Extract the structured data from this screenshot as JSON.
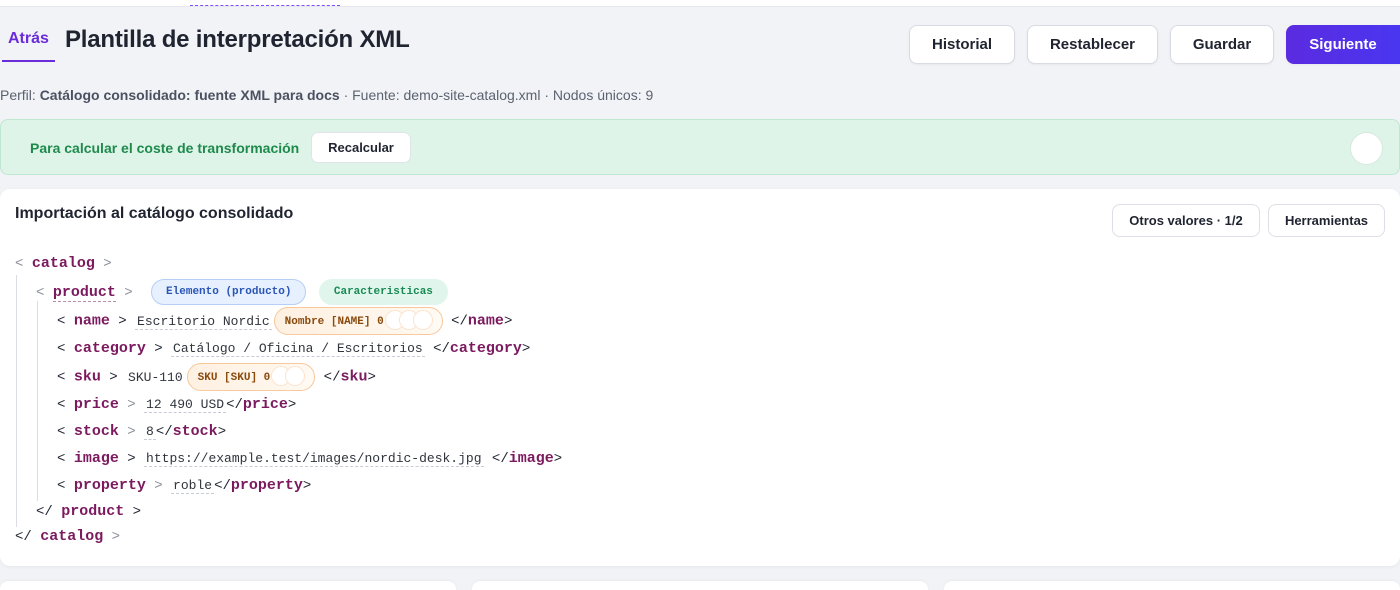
{
  "header": {
    "back_label": "Atrás",
    "title": "Plantilla de interpretación XML",
    "buttons": {
      "history": "Historial",
      "reset": "Restablecer",
      "save": "Guardar",
      "next": "Siguiente"
    }
  },
  "meta": {
    "profile_label": "Perfil: ",
    "profile_value": "Catálogo consolidado: fuente XML para docs",
    "source_text": " · Fuente: demo-site-catalog.xml · Nodos únicos: 9"
  },
  "alert": {
    "text": "Para calcular el coste de transformación",
    "button": "Recalcular"
  },
  "card": {
    "title": "Importación al catálogo consolidado",
    "other_values": "Otros valores · 1/2",
    "tools": "Herramientas"
  },
  "xml": {
    "root_tag": "catalog",
    "item_tag": "product",
    "item_badge": "Elemento (producto)",
    "item_features": "Caracteristicas",
    "fields": [
      {
        "tag": "name",
        "value": "Escritorio Nordic",
        "mapping": "Nombre [NAME] 0"
      },
      {
        "tag": "category",
        "value": "Catálogo / Oficina / Escritorios",
        "mapping": ""
      },
      {
        "tag": "sku",
        "value": "SKU-110",
        "mapping": "SKU [SKU] 0"
      },
      {
        "tag": "price",
        "value": "12 490 USD",
        "mapping": ""
      },
      {
        "tag": "stock",
        "value": "8",
        "mapping": ""
      },
      {
        "tag": "image",
        "value": "https://example.test/images/nordic-desk.jpg",
        "mapping": ""
      },
      {
        "tag": "property",
        "value": "roble",
        "mapping": ""
      }
    ]
  },
  "colors": {
    "accent": "#5b2be0",
    "tag": "#7b1a5e",
    "success_bg": "#def4e8",
    "success_text": "#1e8a4c"
  }
}
